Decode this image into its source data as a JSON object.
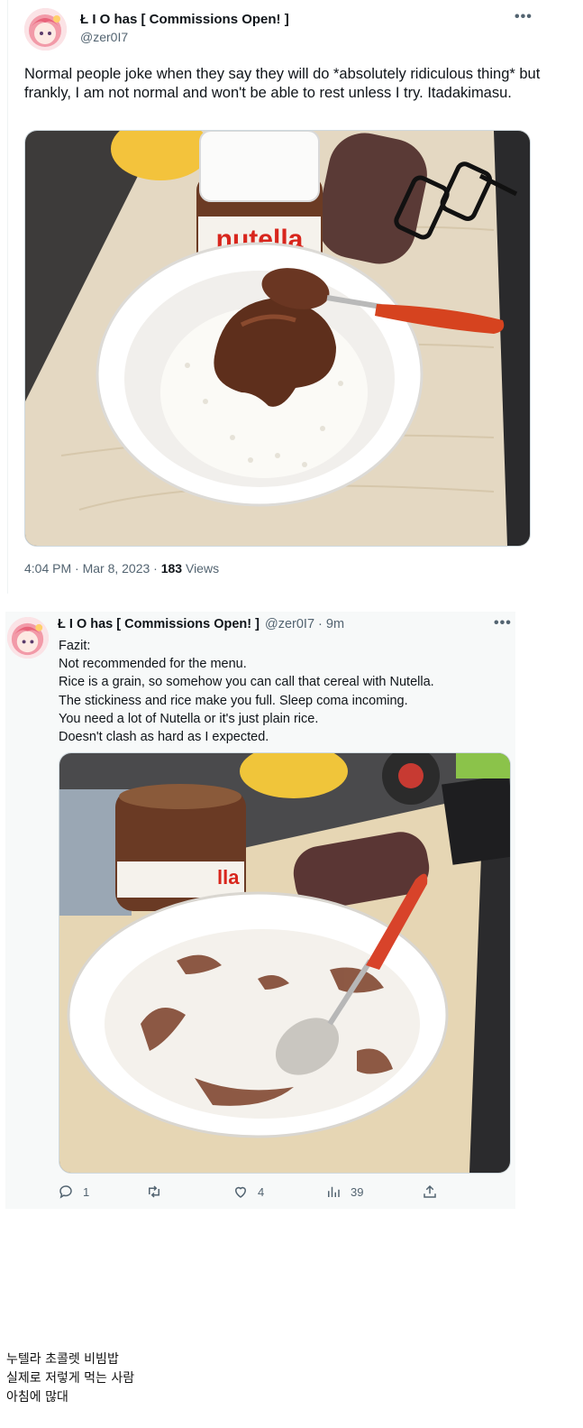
{
  "tweet1": {
    "display_name": "Ł I O has [ Commissions Open! ]",
    "handle": "@zer0I7",
    "more_icon": "more-horizontal-icon",
    "text": "Normal people joke when they say they will do *absolutely ridiculous thing* but frankly, I am not normal and won't be able to rest unless I try. Itadakimasu.",
    "jar_label": "nutella",
    "time": "4:04 PM · Mar 8, 2023 · ",
    "views_count": "183",
    "views_label": " Views"
  },
  "tweet2": {
    "display_name": "Ł I O has [ Commissions Open! ]",
    "handle_time": "@zer0I7 · 9m",
    "lines": [
      "Fazit:",
      "Not recommended for the menu.",
      "Rice is a grain, so somehow you can call that cereal with Nutella.",
      "The stickiness and rice make you full. Sleep coma incoming.",
      "You need a lot of Nutella or it's just plain rice.",
      "Doesn't clash as hard as I expected."
    ],
    "jar_label": "lla",
    "actions": {
      "reply": {
        "icon": "reply-icon",
        "count": "1"
      },
      "retweet": {
        "icon": "retweet-icon",
        "count": ""
      },
      "like": {
        "icon": "heart-icon",
        "count": "4"
      },
      "views": {
        "icon": "views-icon",
        "count": "39"
      },
      "share": {
        "icon": "share-icon",
        "count": ""
      }
    }
  },
  "caption": [
    "누텔라 초콜렛 비빔밥",
    "실제로 저렇게 먹는 사람",
    "아침에 많대"
  ],
  "colors": {
    "text": "#0f1419",
    "secondary": "#536471",
    "tweet2_bg": "#f7f9f9"
  }
}
